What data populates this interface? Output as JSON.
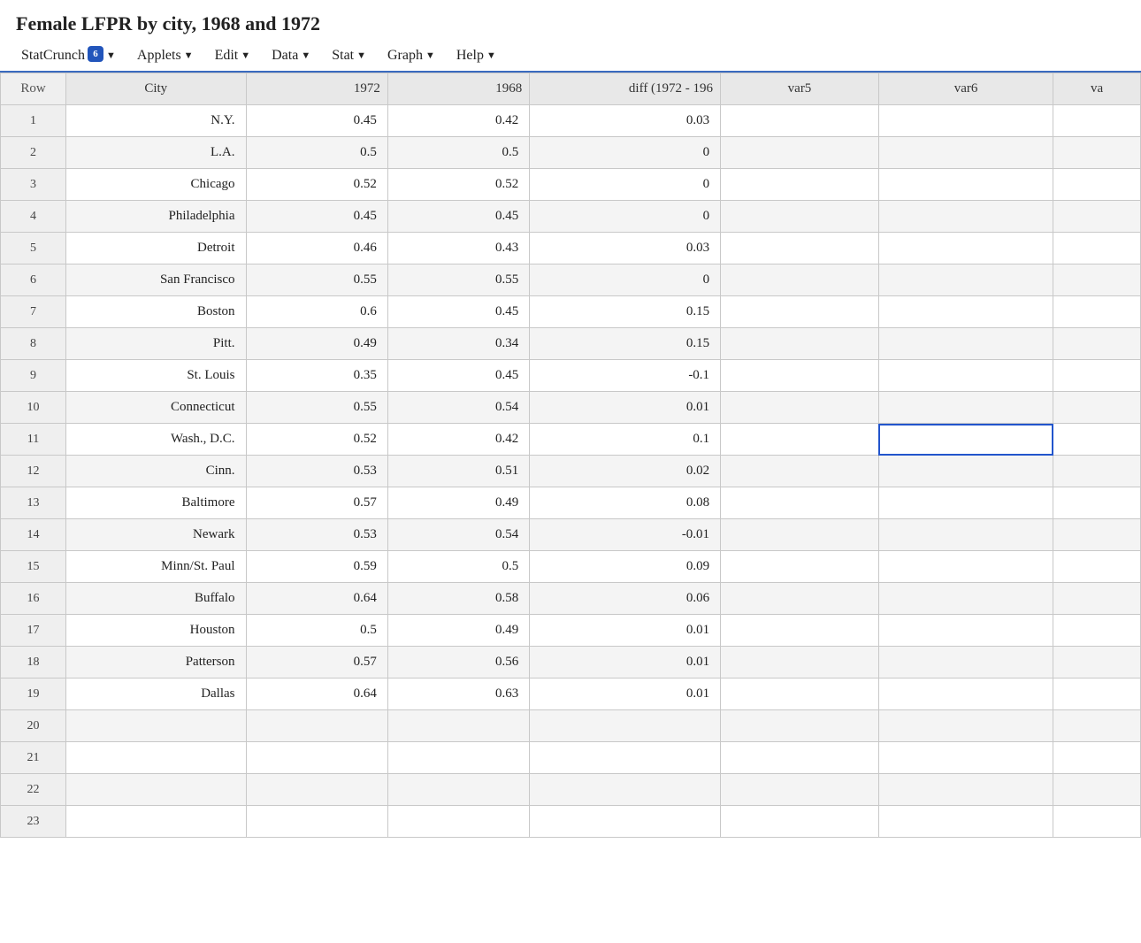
{
  "title": "Female LFPR by city, 1968 and 1972",
  "menu": {
    "items": [
      {
        "id": "statcrunch",
        "label": "StatCrunch",
        "badge": "6",
        "arrow": true
      },
      {
        "id": "applets",
        "label": "Applets",
        "arrow": true
      },
      {
        "id": "edit",
        "label": "Edit",
        "arrow": true
      },
      {
        "id": "data",
        "label": "Data",
        "arrow": true
      },
      {
        "id": "stat",
        "label": "Stat",
        "arrow": true
      },
      {
        "id": "graph",
        "label": "Graph",
        "arrow": true
      },
      {
        "id": "help",
        "label": "Help",
        "arrow": true
      }
    ]
  },
  "columns": [
    {
      "id": "row",
      "label": "Row"
    },
    {
      "id": "city",
      "label": "City"
    },
    {
      "id": "y1972",
      "label": "1972"
    },
    {
      "id": "y1968",
      "label": "1968"
    },
    {
      "id": "diff",
      "label": "diff (1972 - 196"
    },
    {
      "id": "var5",
      "label": "var5"
    },
    {
      "id": "var6",
      "label": "var6"
    },
    {
      "id": "varx",
      "label": "va"
    }
  ],
  "rows": [
    {
      "row": 1,
      "city": "N.Y.",
      "y1972": "0.45",
      "y1968": "0.42",
      "diff": "0.03",
      "var5": "",
      "var6": "",
      "varx": ""
    },
    {
      "row": 2,
      "city": "L.A.",
      "y1972": "0.5",
      "y1968": "0.5",
      "diff": "0",
      "var5": "",
      "var6": "",
      "varx": ""
    },
    {
      "row": 3,
      "city": "Chicago",
      "y1972": "0.52",
      "y1968": "0.52",
      "diff": "0",
      "var5": "",
      "var6": "",
      "varx": ""
    },
    {
      "row": 4,
      "city": "Philadelphia",
      "y1972": "0.45",
      "y1968": "0.45",
      "diff": "0",
      "var5": "",
      "var6": "",
      "varx": ""
    },
    {
      "row": 5,
      "city": "Detroit",
      "y1972": "0.46",
      "y1968": "0.43",
      "diff": "0.03",
      "var5": "",
      "var6": "",
      "varx": ""
    },
    {
      "row": 6,
      "city": "San Francisco",
      "y1972": "0.55",
      "y1968": "0.55",
      "diff": "0",
      "var5": "",
      "var6": "",
      "varx": ""
    },
    {
      "row": 7,
      "city": "Boston",
      "y1972": "0.6",
      "y1968": "0.45",
      "diff": "0.15",
      "var5": "",
      "var6": "",
      "varx": ""
    },
    {
      "row": 8,
      "city": "Pitt.",
      "y1972": "0.49",
      "y1968": "0.34",
      "diff": "0.15",
      "var5": "",
      "var6": "",
      "varx": ""
    },
    {
      "row": 9,
      "city": "St. Louis",
      "y1972": "0.35",
      "y1968": "0.45",
      "diff": "-0.1",
      "var5": "",
      "var6": "",
      "varx": ""
    },
    {
      "row": 10,
      "city": "Connecticut",
      "y1972": "0.55",
      "y1968": "0.54",
      "diff": "0.01",
      "var5": "",
      "var6": "",
      "varx": ""
    },
    {
      "row": 11,
      "city": "Wash., D.C.",
      "y1972": "0.52",
      "y1968": "0.42",
      "diff": "0.1",
      "var5": "",
      "var6": "SELECTED",
      "varx": ""
    },
    {
      "row": 12,
      "city": "Cinn.",
      "y1972": "0.53",
      "y1968": "0.51",
      "diff": "0.02",
      "var5": "",
      "var6": "",
      "varx": ""
    },
    {
      "row": 13,
      "city": "Baltimore",
      "y1972": "0.57",
      "y1968": "0.49",
      "diff": "0.08",
      "var5": "",
      "var6": "",
      "varx": ""
    },
    {
      "row": 14,
      "city": "Newark",
      "y1972": "0.53",
      "y1968": "0.54",
      "diff": "-0.01",
      "var5": "",
      "var6": "",
      "varx": ""
    },
    {
      "row": 15,
      "city": "Minn/St. Paul",
      "y1972": "0.59",
      "y1968": "0.5",
      "diff": "0.09",
      "var5": "",
      "var6": "",
      "varx": ""
    },
    {
      "row": 16,
      "city": "Buffalo",
      "y1972": "0.64",
      "y1968": "0.58",
      "diff": "0.06",
      "var5": "",
      "var6": "",
      "varx": ""
    },
    {
      "row": 17,
      "city": "Houston",
      "y1972": "0.5",
      "y1968": "0.49",
      "diff": "0.01",
      "var5": "",
      "var6": "",
      "varx": ""
    },
    {
      "row": 18,
      "city": "Patterson",
      "y1972": "0.57",
      "y1968": "0.56",
      "diff": "0.01",
      "var5": "",
      "var6": "",
      "varx": ""
    },
    {
      "row": 19,
      "city": "Dallas",
      "y1972": "0.64",
      "y1968": "0.63",
      "diff": "0.01",
      "var5": "",
      "var6": "",
      "varx": ""
    },
    {
      "row": 20,
      "city": "",
      "y1972": "",
      "y1968": "",
      "diff": "",
      "var5": "",
      "var6": "",
      "varx": ""
    },
    {
      "row": 21,
      "city": "",
      "y1972": "",
      "y1968": "",
      "diff": "",
      "var5": "",
      "var6": "",
      "varx": ""
    },
    {
      "row": 22,
      "city": "",
      "y1972": "",
      "y1968": "",
      "diff": "",
      "var5": "",
      "var6": "",
      "varx": ""
    },
    {
      "row": 23,
      "city": "",
      "y1972": "",
      "y1968": "",
      "diff": "",
      "var5": "",
      "var6": "",
      "varx": ""
    }
  ]
}
